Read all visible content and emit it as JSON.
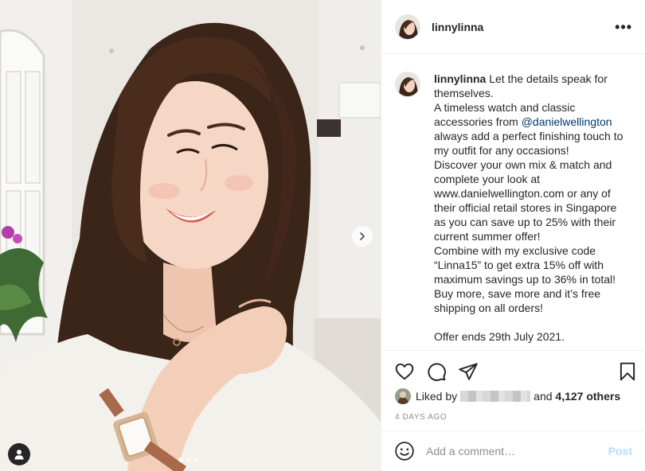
{
  "post": {
    "username": "linnylinna",
    "more_icon": "more-horizontal-icon",
    "caption": {
      "author": "linnylinna",
      "line_intro": "Let the details speak for themselves.",
      "line_2a": "A timeless watch and classic accessories from ",
      "mention": "@danielwellington",
      "line_2b": " always add a perfect finishing touch to my outfit for any occasions!",
      "line_3": "Discover your own mix & match and complete your look at www.danielwellington.com or any of their official retail stores in Singapore as you can save up to 25% with their current summer offer!",
      "line_4": "Combine with my exclusive code “Linna15” to get extra 15% off with maximum savings up to 36% in total!",
      "line_5": "Buy more, save more and it’s free shipping on all orders!",
      "line_6": "Offer ends 29th July 2021."
    },
    "likes": {
      "prefix": "Liked by",
      "connector": "and",
      "others": "4,127 others"
    },
    "timestamp": "4 DAYS AGO",
    "comment": {
      "placeholder": "Add a comment…",
      "post_label": "Post"
    },
    "carousel": {
      "slides": 3,
      "active_index": 0
    }
  },
  "colors": {
    "mention": "#00376b",
    "post_disabled": "#b2dffc",
    "secondary_text": "#8e8e8e",
    "border": "#efefef"
  }
}
